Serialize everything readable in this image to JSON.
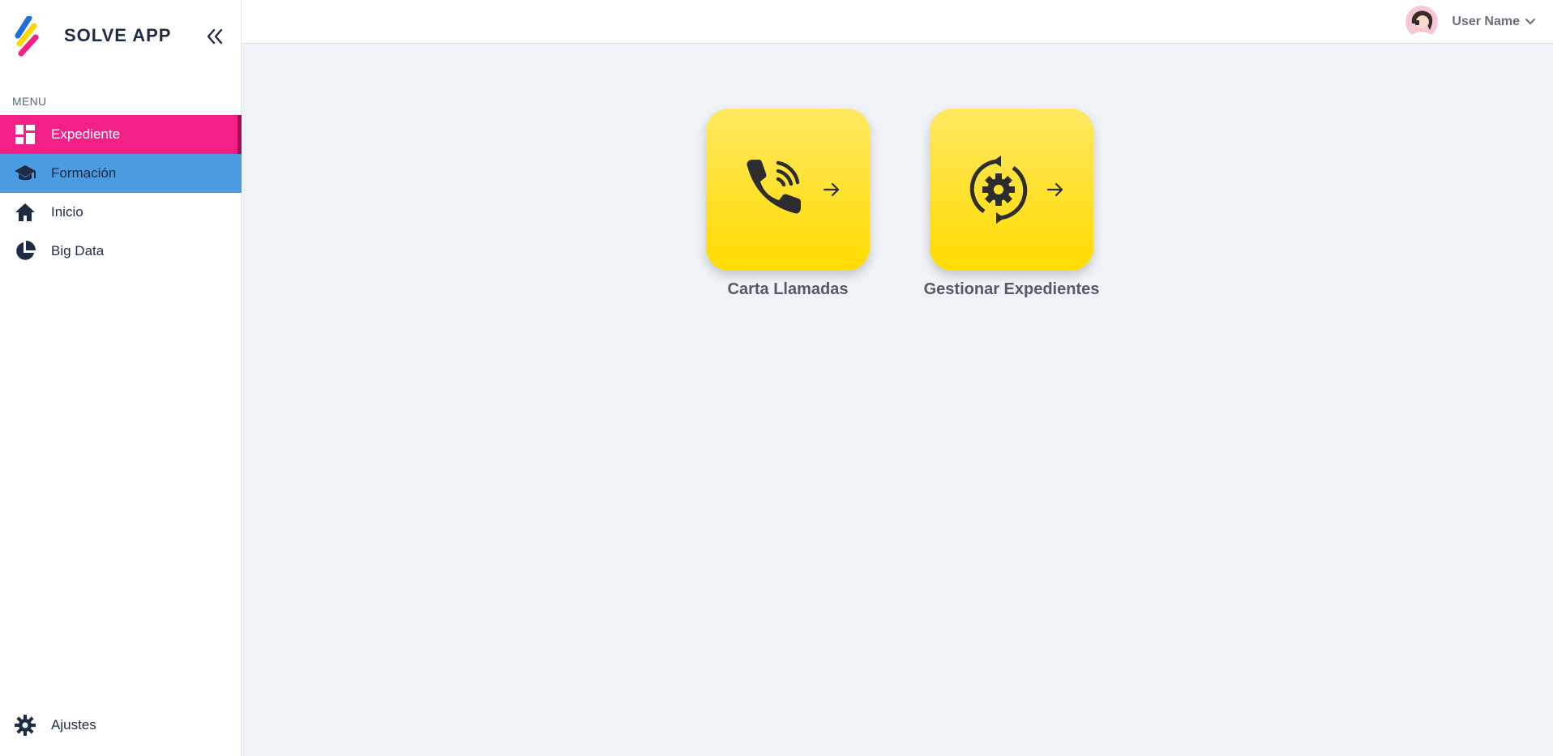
{
  "app": {
    "title": "SOLVE APP"
  },
  "sidebar": {
    "menu_label": "MENU",
    "items": [
      {
        "label": "Expediente",
        "icon": "dashboard-icon",
        "state": "active"
      },
      {
        "label": "Formación",
        "icon": "graduation-cap-icon",
        "state": "hover"
      },
      {
        "label": "Inicio",
        "icon": "home-icon",
        "state": ""
      },
      {
        "label": "Big Data",
        "icon": "pie-chart-icon",
        "state": ""
      }
    ],
    "settings_label": "Ajustes"
  },
  "topbar": {
    "user_name": "User Name"
  },
  "cards": [
    {
      "label": "Carta Llamadas",
      "icon": "phone-ringing-icon"
    },
    {
      "label": "Gestionar Expedientes",
      "icon": "gear-sync-icon"
    }
  ],
  "colors": {
    "accent_pink": "#f41f87",
    "hover_blue": "#4a9be0",
    "tile_yellow": "#ffdb00",
    "background": "#eff2f7"
  }
}
